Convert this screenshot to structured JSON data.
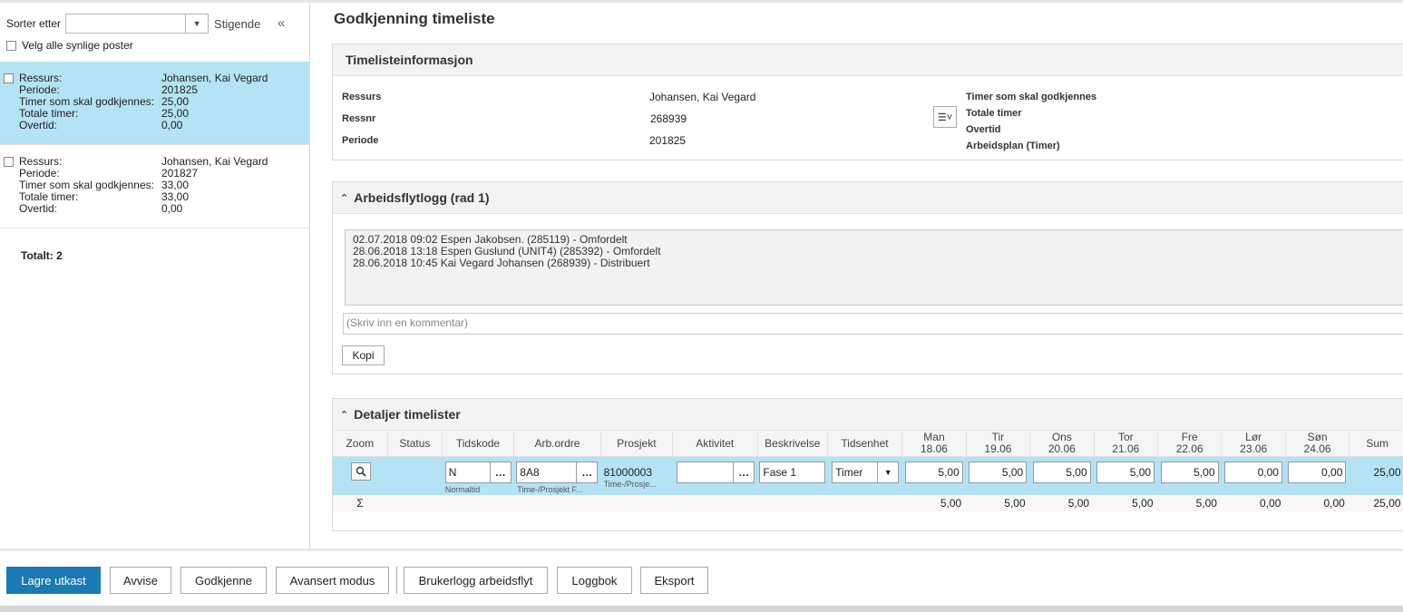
{
  "left": {
    "sort_label": "Sorter etter",
    "sort_value": "",
    "sort_direction": "Stigende",
    "select_all": "Velg alle synlige poster",
    "field_labels": [
      "Ressurs:",
      "Periode:",
      "Timer som skal godkjennes:",
      "Totale timer:",
      "Overtid:"
    ],
    "items": [
      {
        "values": [
          "Johansen, Kai Vegard",
          "201825",
          "25,00",
          "25,00",
          "0,00"
        ],
        "selected": true
      },
      {
        "values": [
          "Johansen, Kai Vegard",
          "201827",
          "33,00",
          "33,00",
          "0,00"
        ],
        "selected": false
      }
    ],
    "total": "Totalt: 2"
  },
  "main": {
    "title": "Godkjenning timeliste",
    "info_panel": {
      "title": "Timelisteinformasjon",
      "labels": [
        "Ressurs",
        "Ressnr",
        "Periode"
      ],
      "values": [
        "Johansen, Kai Vegard",
        "268939",
        "201825"
      ],
      "right_labels": [
        "Timer som skal godkjennes",
        "Totale timer",
        "Overtid",
        "Arbeidsplan (Timer)"
      ]
    },
    "workflow_panel": {
      "title": "Arbeidsflytlogg (rad 1)",
      "log": [
        "02.07.2018 09:02 Espen Jakobsen. (285119) - Omfordelt",
        "28.06.2018 13:18 Espen Guslund (UNIT4) (285392) - Omfordelt",
        "28.06.2018 10:45 Kai Vegard Johansen (268939) - Distribuert"
      ],
      "comment_placeholder": "(Skriv inn en kommentar)",
      "copy_button": "Kopi"
    },
    "details_panel": {
      "title": "Detaljer timelister",
      "columns": [
        "Zoom",
        "Status",
        "Tidskode",
        "Arb.ordre",
        "Prosjekt",
        "Aktivitet",
        "Beskrivelse",
        "Tidsenhet"
      ],
      "days": [
        {
          "day": "Man",
          "date": "18.06"
        },
        {
          "day": "Tir",
          "date": "19.06"
        },
        {
          "day": "Ons",
          "date": "20.06"
        },
        {
          "day": "Tor",
          "date": "21.06"
        },
        {
          "day": "Fre",
          "date": "22.06"
        },
        {
          "day": "Lør",
          "date": "23.06"
        },
        {
          "day": "Søn",
          "date": "24.06"
        }
      ],
      "sum_col": "Sum",
      "row": {
        "tidskode": "N",
        "tidskode_sub": "Normaltid",
        "arbordre": "8A8",
        "arbordre_sub": "Time-/Prosjekt F...",
        "prosjekt": "81000003",
        "prosjekt_sub": "Time-/Prosje...",
        "aktivitet": "",
        "beskrivelse": "Fase 1",
        "tidsenhet": "Timer",
        "hours": [
          "5,00",
          "5,00",
          "5,00",
          "5,00",
          "5,00",
          "0,00",
          "0,00"
        ],
        "sum": "25,00"
      },
      "sum_row": {
        "symbol": "Σ",
        "hours": [
          "5,00",
          "5,00",
          "5,00",
          "5,00",
          "5,00",
          "0,00",
          "0,00"
        ],
        "sum": "25,00"
      }
    }
  },
  "footer": {
    "save_draft": "Lagre utkast",
    "reject": "Avvise",
    "approve": "Godkjenne",
    "advanced": "Avansert modus",
    "user_log": "Brukerlogg arbeidsflyt",
    "logbook": "Loggbok",
    "export": "Eksport"
  },
  "colors": {
    "selected_row": "#b3e3f4",
    "primary_button": "#1a7ab4"
  }
}
